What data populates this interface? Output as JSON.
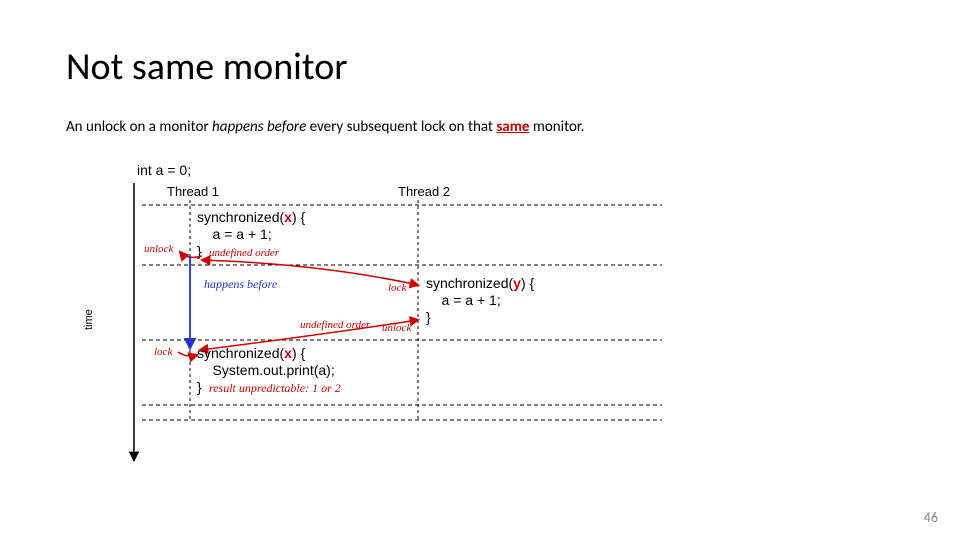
{
  "title": "Not same monitor",
  "subtitle": {
    "pre": "An unlock on a monitor ",
    "emph": "happens before",
    "mid": " every subsequent lock on that ",
    "key": "same",
    "post": " monitor."
  },
  "page_number": "46",
  "diagram": {
    "init_stmt": "int a = 0;",
    "thread1_label": "Thread 1",
    "thread2_label": "Thread 2",
    "time_label": "time",
    "thread1_block1": {
      "line1_a": "synchronized(",
      "line1_x": "x",
      "line1_b": ") {",
      "line2": "    a = a + 1;",
      "line3": "}",
      "undef": "undefined order"
    },
    "happens_before": "happens before",
    "thread1_block2": {
      "line1_a": "synchronized(",
      "line1_x": "x",
      "line1_b": ") {",
      "line2": "    System.out.print(a);",
      "line3": "}",
      "result": "result unpredictable: 1 or 2"
    },
    "thread2_block": {
      "line1_a": "synchronized(",
      "line1_y": "y",
      "line1_b": ") {",
      "line2": "    a = a + 1;",
      "line3": "}"
    },
    "undef_between_threads": "undefined order",
    "unlock_label1": "unlock",
    "lock_label1": "lock",
    "lock_label2": "lock",
    "unlock_label2": "unlock"
  }
}
